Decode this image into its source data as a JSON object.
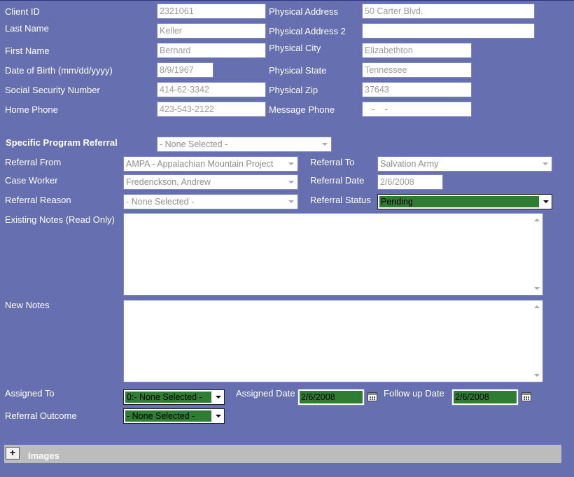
{
  "client": {
    "client_id": {
      "label": "Client ID",
      "value": "2321061"
    },
    "last_name": {
      "label": "Last Name",
      "value": "Keller"
    },
    "first_name": {
      "label": "First Name",
      "value": "Bernard"
    },
    "dob": {
      "label": "Date of Birth (mm/dd/yyyy)",
      "value": "8/9/1967"
    },
    "ssn": {
      "label": "Social Security Number",
      "value": "414-62-3342"
    },
    "home_phone": {
      "label": "Home Phone",
      "value": "423-543-2122"
    },
    "physical_address": {
      "label": "Physical Address",
      "value": "50 Carter Blvd."
    },
    "physical_address2": {
      "label": "Physical Address 2",
      "value": ""
    },
    "physical_city": {
      "label": "Physical City",
      "value": "Elizabethton"
    },
    "physical_state": {
      "label": "Physical State",
      "value": "Tennessee"
    },
    "physical_zip": {
      "label": "Physical Zip",
      "value": "37643"
    },
    "message_phone": {
      "label": "Message Phone",
      "value": "   -    -"
    }
  },
  "referral": {
    "specific_program": {
      "label": "Specific Program Referral",
      "value": "- None Selected -"
    },
    "from": {
      "label": "Referral From",
      "value": "AMPA - Appalachian Mountain Project"
    },
    "to": {
      "label": "Referral To",
      "value": "Salvation Army"
    },
    "case_worker": {
      "label": "Case Worker",
      "value": "Frederickson, Andrew"
    },
    "date": {
      "label": "Referral Date",
      "value": "2/6/2008"
    },
    "reason": {
      "label": "Referral Reason",
      "value": "- None Selected -"
    },
    "status": {
      "label": "Referral Status",
      "value": "Pending"
    },
    "existing_notes": {
      "label": "Existing Notes (Read Only)",
      "value": ""
    },
    "new_notes": {
      "label": "New Notes",
      "value": ""
    },
    "assigned_to": {
      "label": "Assigned To",
      "value": "0:- None Selected -"
    },
    "assigned_date": {
      "label": "Assigned Date",
      "value": "2/6/2008"
    },
    "followup_date": {
      "label": "Follow up Date",
      "value": "2/6/2008"
    },
    "outcome": {
      "label": "Referral Outcome",
      "value": "- None Selected -"
    }
  },
  "images": {
    "label": "Images",
    "toggle": "+"
  },
  "colors": {
    "background": "#6670b0",
    "highlight": "#2e7d32",
    "panel": "#bcbcbc"
  }
}
